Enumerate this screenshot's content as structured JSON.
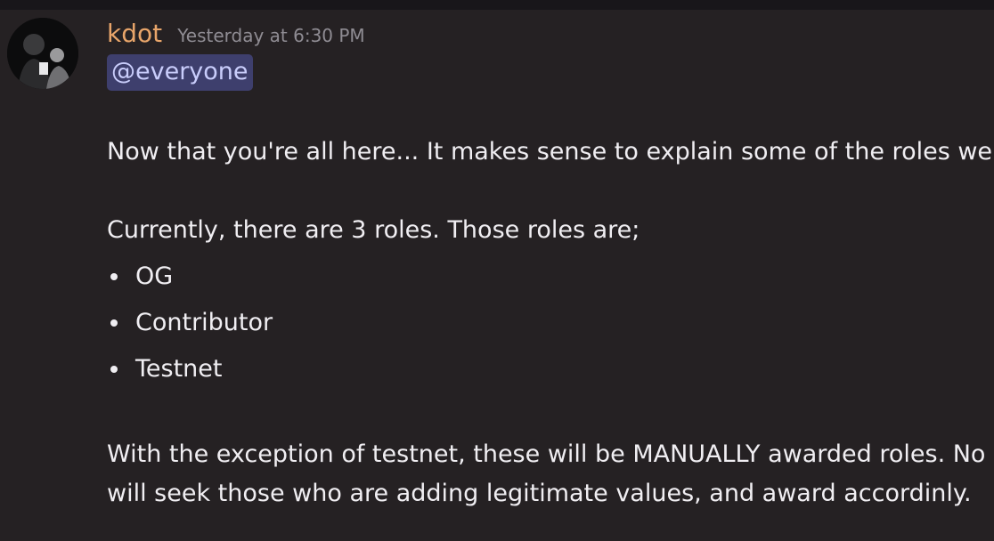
{
  "message": {
    "author": "kdot",
    "timestamp": "Yesterday at 6:30 PM",
    "mention": "@everyone",
    "paragraphs": {
      "intro": "Now that you're all here... It makes sense to explain some of the roles we h",
      "roles_intro": "Currently, there are 3 roles. Those roles are;",
      "exception_line1": "With the exception of testnet, these will be MANUALLY awarded roles. No",
      "exception_line2": "will seek those who are adding legitimate values, and award accordinly."
    },
    "roles": [
      {
        "label": "OG"
      },
      {
        "label": "Contributor"
      },
      {
        "label": "Testnet"
      }
    ]
  },
  "colors": {
    "background": "#252123",
    "username": "#e8a56a",
    "mention_bg": "#3e3f6d",
    "mention_text": "#c9cdfb"
  },
  "icons": {
    "avatar": "user-avatar"
  }
}
